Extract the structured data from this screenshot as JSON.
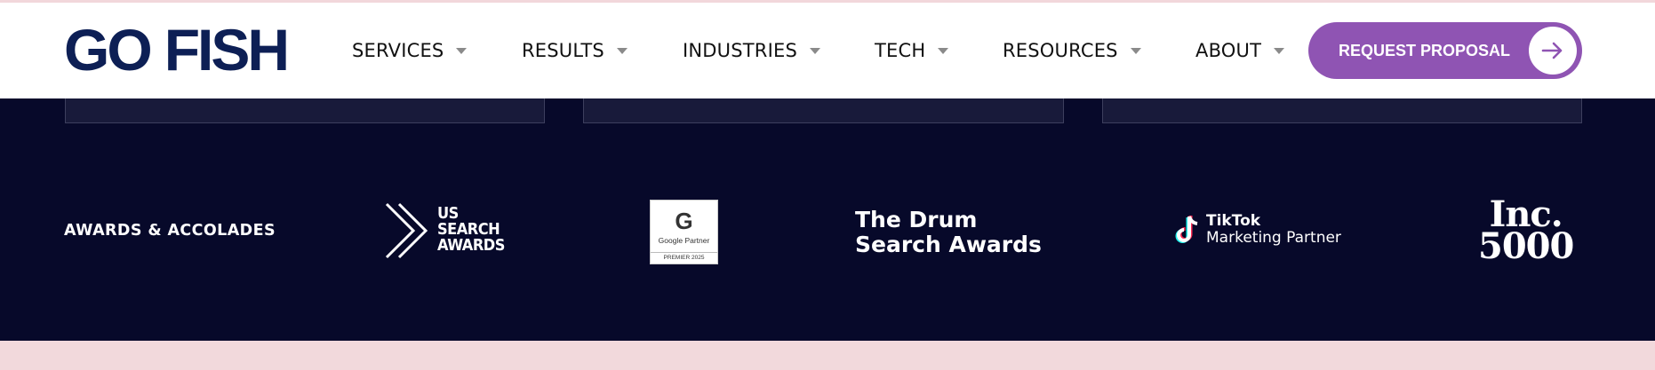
{
  "brand": {
    "logo_word1": "GO",
    "logo_word2": "FISH"
  },
  "nav": {
    "items": [
      {
        "label": "SERVICES"
      },
      {
        "label": "RESULTS"
      },
      {
        "label": "INDUSTRIES"
      },
      {
        "label": "TECH"
      },
      {
        "label": "RESOURCES"
      },
      {
        "label": "ABOUT"
      }
    ],
    "cta_label": "REQUEST PROPOSAL"
  },
  "awards": {
    "title": "AWARDS & ACCOLADES",
    "us_search": [
      "US",
      "SEARCH",
      "AWARDS"
    ],
    "google": {
      "letter": "G",
      "label": "Google Partner",
      "foot": "PREMIER 2025"
    },
    "drum": [
      "The Drum",
      "Search Awards"
    ],
    "tiktok": [
      "TikTok",
      "Marketing Partner"
    ],
    "inc": [
      "Inc.",
      "5000"
    ]
  },
  "colors": {
    "brand_navy": "#0d1f55",
    "accent_purple": "#8f54b3",
    "band_bg": "#07092a",
    "footer_pink": "#f2d9dc"
  }
}
